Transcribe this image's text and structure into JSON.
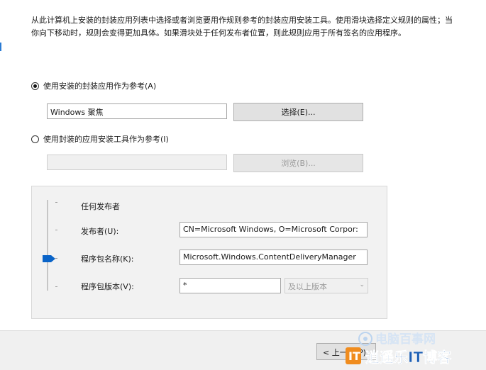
{
  "description": "从此计算机上安装的封装应用列表中选择或者浏览要用作规则参考的封装应用安装工具。使用滑块选择定义规则的属性；当你向下移动时，规则会变得更加具体。如果滑块处于任何发布者位置，则此规则应用于所有签名的应用程序。",
  "option_installed": {
    "label": "使用安装的封装应用作为参考(A)",
    "selected": true,
    "value": "Windows 聚焦",
    "button_label": "选择(E)..."
  },
  "option_installer": {
    "label": "使用封装的应用安装工具作为参考(I)",
    "selected": false,
    "value": "",
    "button_label": "浏览(B)..."
  },
  "rule_scope": {
    "any_publisher_label": "任何发布者",
    "publisher_label": "发布者(U):",
    "publisher_value": "CN=Microsoft Windows, O=Microsoft Corpor:",
    "package_name_label": "程序包名称(K):",
    "package_name_value": "Microsoft.Windows.ContentDeliveryManager",
    "package_version_label": "程序包版本(V):",
    "package_version_value": "*",
    "version_condition": "及以上版本"
  },
  "footer": {
    "back_label": "< 上一步(P)"
  },
  "watermark": {
    "line1": "电脑百事网",
    "line2": "逍遥乐IT博客"
  },
  "colors": {
    "accent": "#0a64c8",
    "watermark_orange": "#f08c1e",
    "watermark_blue": "#1e5fb4"
  }
}
